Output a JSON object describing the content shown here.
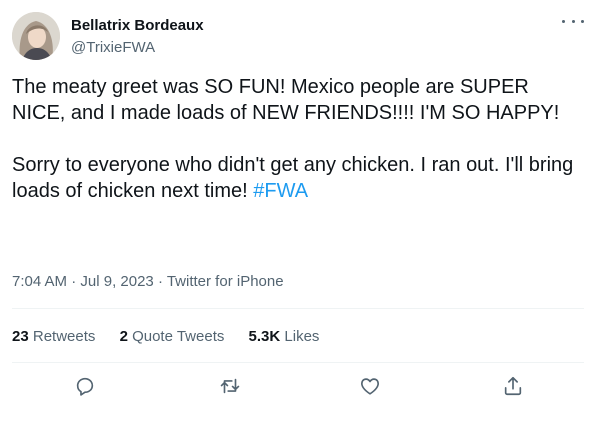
{
  "tweet": {
    "author_name": "Bellatrix Bordeaux",
    "author_handle": "@TrixieFWA",
    "text_line1": "The meaty greet was SO FUN! Mexico people are SUPER NICE, and I made loads of NEW FRIENDS!!!! I'M SO HAPPY!",
    "text_line2": "Sorry to everyone who didn't get any chicken. I ran out. I'll bring loads of chicken next time! ",
    "hashtag": "#FWA",
    "time": "7:04 AM",
    "date": "Jul 9, 2023",
    "source": "Twitter for iPhone",
    "separator": " · "
  },
  "stats": {
    "retweets_count": "23",
    "retweets_label": "Retweets",
    "quotes_count": "2",
    "quotes_label": "Quote Tweets",
    "likes_count": "5.3K",
    "likes_label": "Likes"
  },
  "icons": {
    "reply": "reply-icon",
    "retweet": "retweet-icon",
    "like": "heart-icon",
    "share": "share-icon",
    "more": "more-icon"
  },
  "colors": {
    "text": "#0f1419",
    "secondary": "#536471",
    "link": "#1d9bf0",
    "divider": "#eff3f4"
  }
}
